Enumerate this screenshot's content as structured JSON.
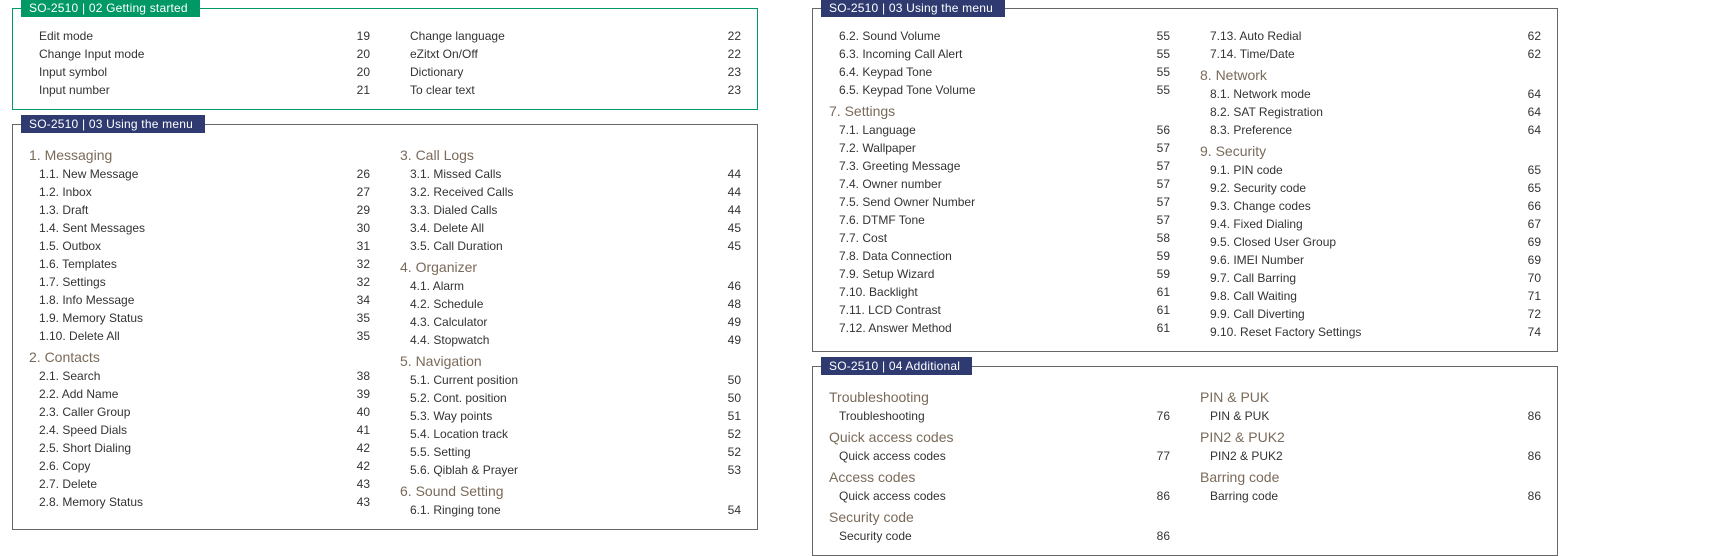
{
  "tabs": {
    "t02": "SO-2510 | 02 Getting started",
    "t03": "SO-2510 | 03 Using the menu",
    "t04": "SO-2510 | 04 Additional"
  },
  "box02": {
    "colA": [
      {
        "label": "Edit mode",
        "pg": "19"
      },
      {
        "label": "Change Input mode",
        "pg": "20"
      },
      {
        "label": "Input symbol",
        "pg": "20"
      },
      {
        "label": "Input number",
        "pg": "21"
      }
    ],
    "colB": [
      {
        "label": "Change language",
        "pg": "22"
      },
      {
        "label": "eZitxt On/Off",
        "pg": "22"
      },
      {
        "label": "Dictionary",
        "pg": "23"
      },
      {
        "label": "To clear text",
        "pg": "23"
      }
    ]
  },
  "box03L": {
    "s1_head": "1. Messaging",
    "s1": [
      {
        "label": "1.1. New Message",
        "pg": "26"
      },
      {
        "label": "1.2. Inbox",
        "pg": "27"
      },
      {
        "label": "1.3. Draft",
        "pg": "29"
      },
      {
        "label": "1.4. Sent Messages",
        "pg": "30"
      },
      {
        "label": "1.5. Outbox",
        "pg": "31"
      },
      {
        "label": "1.6. Templates",
        "pg": "32"
      },
      {
        "label": "1.7. Settings",
        "pg": "32"
      },
      {
        "label": "1.8. Info Message",
        "pg": "34"
      },
      {
        "label": "1.9. Memory Status",
        "pg": "35"
      },
      {
        "label": "1.10. Delete All",
        "pg": "35"
      }
    ],
    "s2_head": "2. Contacts",
    "s2": [
      {
        "label": "2.1. Search",
        "pg": "38"
      },
      {
        "label": "2.2. Add Name",
        "pg": "39"
      },
      {
        "label": "2.3. Caller Group",
        "pg": "40"
      },
      {
        "label": "2.4. Speed Dials",
        "pg": "41"
      },
      {
        "label": "2.5. Short Dialing",
        "pg": "42"
      },
      {
        "label": "2.6. Copy",
        "pg": "42"
      },
      {
        "label": "2.7. Delete",
        "pg": "43"
      },
      {
        "label": "2.8. Memory Status",
        "pg": "43"
      }
    ],
    "s3_head": "3. Call Logs",
    "s3": [
      {
        "label": "3.1. Missed Calls",
        "pg": "44"
      },
      {
        "label": "3.2. Received Calls",
        "pg": "44"
      },
      {
        "label": "3.3. Dialed Calls",
        "pg": "44"
      },
      {
        "label": "3.4. Delete All",
        "pg": "45"
      },
      {
        "label": "3.5. Call Duration",
        "pg": "45"
      }
    ],
    "s4_head": "4. Organizer",
    "s4": [
      {
        "label": "4.1. Alarm",
        "pg": "46"
      },
      {
        "label": "4.2. Schedule",
        "pg": "48"
      },
      {
        "label": "4.3. Calculator",
        "pg": "49"
      },
      {
        "label": "4.4. Stopwatch",
        "pg": "49"
      }
    ],
    "s5_head": "5. Navigation",
    "s5": [
      {
        "label": "5.1. Current position",
        "pg": "50"
      },
      {
        "label": "5.2. Cont. position",
        "pg": "50"
      },
      {
        "label": "5.3. Way points",
        "pg": "51"
      },
      {
        "label": "5.4. Location track",
        "pg": "52"
      },
      {
        "label": "5.5. Setting",
        "pg": "52"
      },
      {
        "label": "5.6. Qiblah & Prayer",
        "pg": "53"
      }
    ],
    "s6_head": "6. Sound Setting",
    "s6": [
      {
        "label": "6.1. Ringing tone",
        "pg": "54"
      }
    ]
  },
  "box03R": {
    "s6b": [
      {
        "label": "6.2. Sound Volume",
        "pg": "55"
      },
      {
        "label": "6.3. Incoming Call Alert",
        "pg": "55"
      },
      {
        "label": "6.4. Keypad Tone",
        "pg": "55"
      },
      {
        "label": "6.5. Keypad Tone Volume",
        "pg": "55"
      }
    ],
    "s7_head": "7. Settings",
    "s7": [
      {
        "label": "7.1. Language",
        "pg": "56"
      },
      {
        "label": "7.2. Wallpaper",
        "pg": "57"
      },
      {
        "label": "7.3. Greeting Message",
        "pg": "57"
      },
      {
        "label": "7.4. Owner number",
        "pg": "57"
      },
      {
        "label": "7.5. Send Owner Number",
        "pg": "57"
      },
      {
        "label": "7.6. DTMF Tone",
        "pg": "57"
      },
      {
        "label": "7.7. Cost",
        "pg": "58"
      },
      {
        "label": "7.8. Data Connection",
        "pg": "59"
      },
      {
        "label": "7.9. Setup Wizard",
        "pg": "59"
      },
      {
        "label": "7.10. Backlight",
        "pg": "61"
      },
      {
        "label": "7.11. LCD Contrast",
        "pg": "61"
      },
      {
        "label": "7.12. Answer Method",
        "pg": "61"
      }
    ],
    "s7b": [
      {
        "label": "7.13. Auto Redial",
        "pg": "62"
      },
      {
        "label": "7.14. Time/Date",
        "pg": "62"
      }
    ],
    "s8_head": "8. Network",
    "s8": [
      {
        "label": "8.1. Network mode",
        "pg": "64"
      },
      {
        "label": "8.2. SAT Registration",
        "pg": "64"
      },
      {
        "label": "8.3. Preference",
        "pg": "64"
      }
    ],
    "s9_head": "9. Security",
    "s9": [
      {
        "label": "9.1. PIN code",
        "pg": "65"
      },
      {
        "label": "9.2. Security code",
        "pg": "65"
      },
      {
        "label": "9.3. Change codes",
        "pg": "66"
      },
      {
        "label": "9.4. Fixed Dialing",
        "pg": "67"
      },
      {
        "label": "9.5. Closed User Group",
        "pg": "69"
      },
      {
        "label": "9.6. IMEI Number",
        "pg": "69"
      },
      {
        "label": "9.7. Call Barring",
        "pg": "70"
      },
      {
        "label": "9.8. Call Waiting",
        "pg": "71"
      },
      {
        "label": "9.9. Call Diverting",
        "pg": "72"
      },
      {
        "label": "9.10. Reset Factory Settings",
        "pg": "74"
      }
    ]
  },
  "box04": {
    "colA": [
      {
        "head": "Troubleshooting",
        "label": "Troubleshooting",
        "pg": "76"
      },
      {
        "head": "Quick access codes",
        "label": "Quick access codes",
        "pg": "77"
      },
      {
        "head": "Access codes",
        "label": "Quick access codes",
        "pg": "86"
      },
      {
        "head": "Security code",
        "label": "Security code",
        "pg": "86"
      }
    ],
    "colB": [
      {
        "head": "PIN & PUK",
        "label": "PIN & PUK",
        "pg": "86"
      },
      {
        "head": "PIN2 & PUK2",
        "label": "PIN2 & PUK2",
        "pg": "86"
      },
      {
        "head": "Barring code",
        "label": "Barring code",
        "pg": "86"
      }
    ]
  }
}
